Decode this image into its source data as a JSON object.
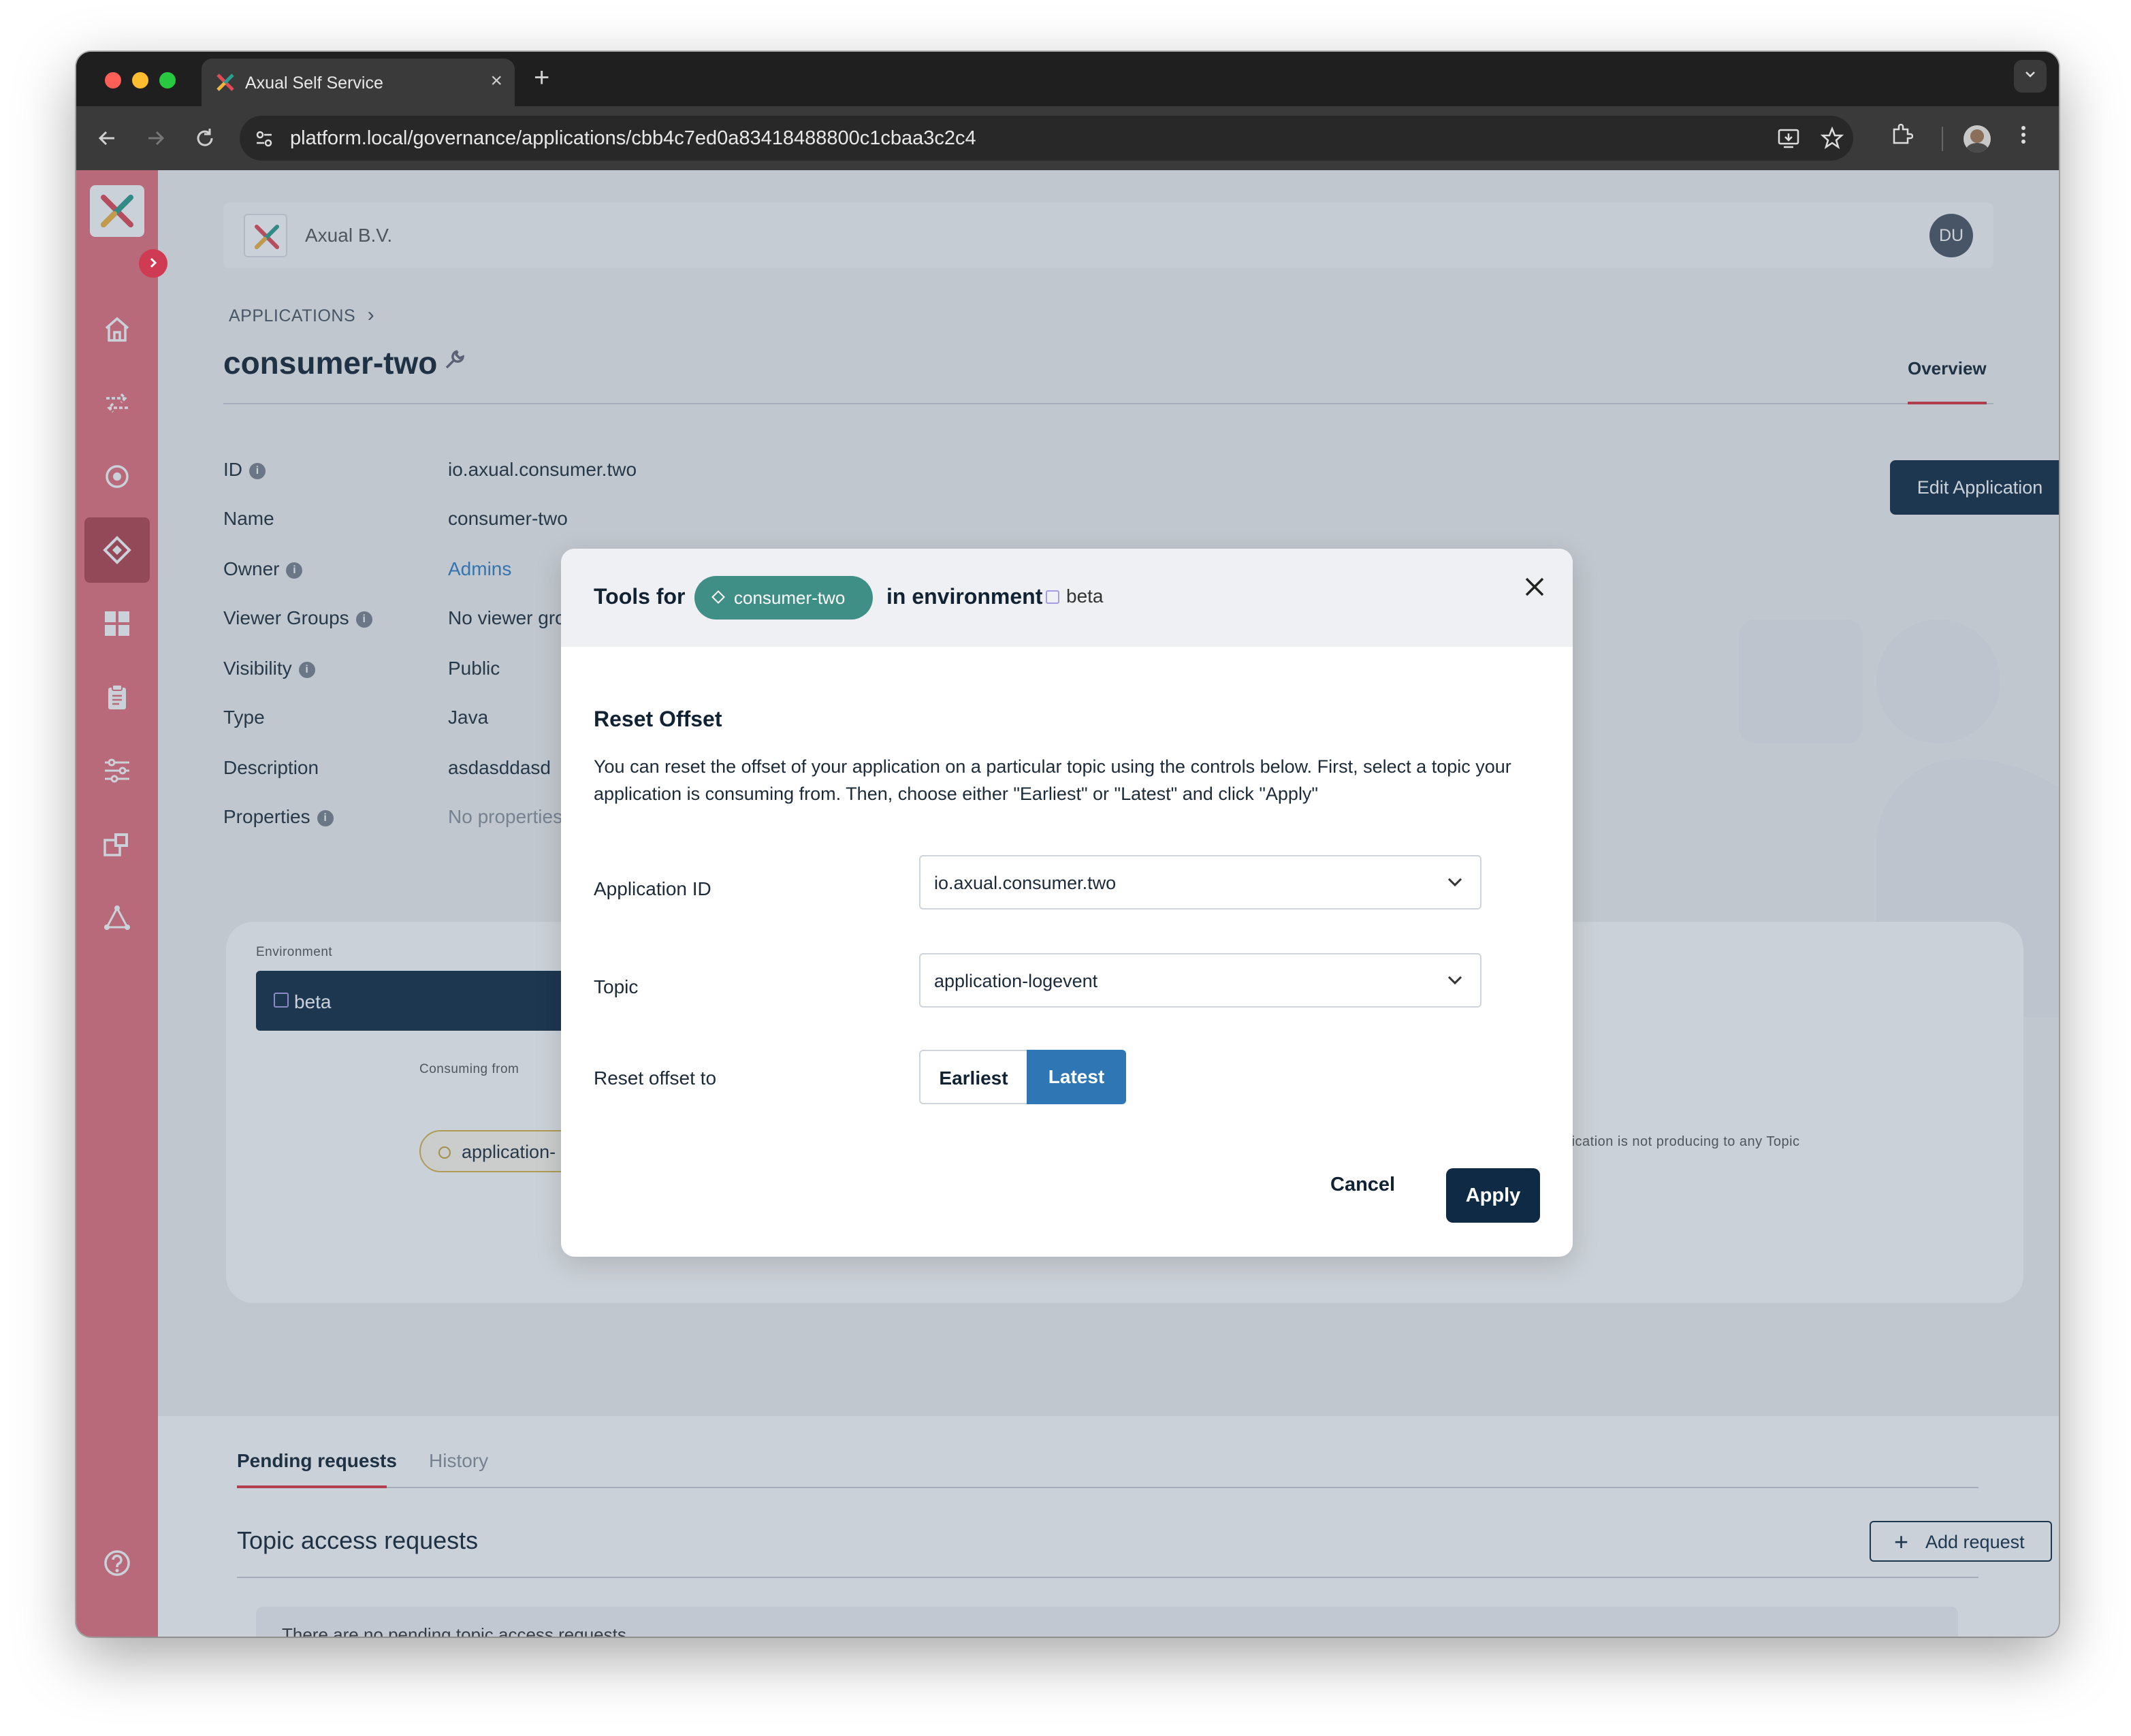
{
  "browser": {
    "tab_title": "Axual Self Service",
    "tab_close": "×",
    "new_tab": "+",
    "url": "platform.local/governance/applications/cbb4c7ed0a83418488800c1cbaa3c2c4"
  },
  "header": {
    "org_name": "Axual B.V.",
    "avatar_initials": "DU"
  },
  "breadcrumb": {
    "label": "APPLICATIONS",
    "chevron": "›"
  },
  "page": {
    "title": "consumer-two",
    "tab_overview": "Overview",
    "edit_button": "Edit Application"
  },
  "details": [
    {
      "label": "ID",
      "value": "io.axual.consumer.two"
    },
    {
      "label": "Name",
      "value": "consumer-two"
    },
    {
      "label": "Owner",
      "value": "Admins"
    },
    {
      "label": "Viewer Groups",
      "value": "No viewer gro"
    },
    {
      "label": "Visibility",
      "value": "Public"
    },
    {
      "label": "Type",
      "value": "Java"
    },
    {
      "label": "Description",
      "value": "asdasddasd"
    },
    {
      "label": "Properties",
      "value": "No properties"
    }
  ],
  "environment_card": {
    "label": "Environment",
    "env_name": "beta",
    "consuming_from": "Consuming from",
    "topic": "application-",
    "producing_note": "plication is not producing to any Topic"
  },
  "lower": {
    "tab_pending": "Pending requests",
    "tab_history": "History",
    "section_title": "Topic access requests",
    "add_request": "Add request",
    "add_icon": "+",
    "empty_text": "There are no pending topic access requests"
  },
  "modal": {
    "tools_for": "Tools for",
    "app_chip": "consumer-two",
    "in_environment": "in environment",
    "env": "beta",
    "close": "×",
    "title": "Reset Offset",
    "description": "You can reset the offset of your application on a particular topic using the controls below. First, select a topic your application is consuming from. Then, choose either \"Earliest\" or \"Latest\" and click \"Apply\"",
    "application_id_label": "Application ID",
    "application_id_value": "io.axual.consumer.two",
    "topic_label": "Topic",
    "topic_value": "application-logevent",
    "reset_label": "Reset offset to",
    "earliest": "Earliest",
    "latest": "Latest",
    "selected_option": "Latest",
    "cancel": "Cancel",
    "apply": "Apply"
  },
  "icons": {
    "sidebar": [
      "home-icon",
      "streams-icon",
      "topics-icon",
      "applications-icon",
      "dashboard-icon",
      "clipboard-icon",
      "settings-sliders-icon",
      "schemas-icon",
      "network-icon",
      "help-icon"
    ],
    "chevron_down": "⌄"
  },
  "colors": {
    "sidebar": "#e5717d",
    "primary_dark": "#0f2a44",
    "accent_red": "#d9353f",
    "chip_teal": "#3f8f86",
    "selected_blue": "#2f76b5"
  }
}
